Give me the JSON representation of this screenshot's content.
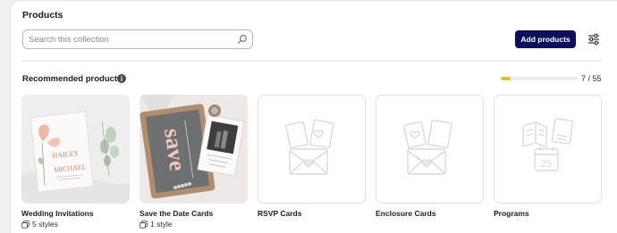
{
  "header": {
    "title": "Products"
  },
  "search": {
    "placeholder": "Search this collection"
  },
  "toolbar": {
    "add_label": "Add products"
  },
  "recommended": {
    "title": "Recommended products",
    "progress_text": "7 / 55",
    "progress_fraction": 0.13,
    "progress_color": "#e2c22a"
  },
  "products": [
    {
      "name": "Wedding Invitations",
      "styles": "5 styles",
      "has_image": true
    },
    {
      "name": "Save the Date Cards",
      "styles": "1 style",
      "has_image": true
    },
    {
      "name": "RSVP Cards",
      "styles": "",
      "has_image": false,
      "icon": "envelope-cards-icon"
    },
    {
      "name": "Enclosure Cards",
      "styles": "",
      "has_image": false,
      "icon": "envelope-cards-icon"
    },
    {
      "name": "Programs",
      "styles": "",
      "has_image": false,
      "icon": "booklet-calendar-icon"
    }
  ],
  "photo_texts": {
    "invitation_names_1": "HAILEY",
    "invitation_names_2": "MICHAEL",
    "save_word": "save",
    "calendar_day": "25"
  },
  "colors": {
    "primary": "#0b0f5e",
    "accent": "#e2c22a"
  }
}
